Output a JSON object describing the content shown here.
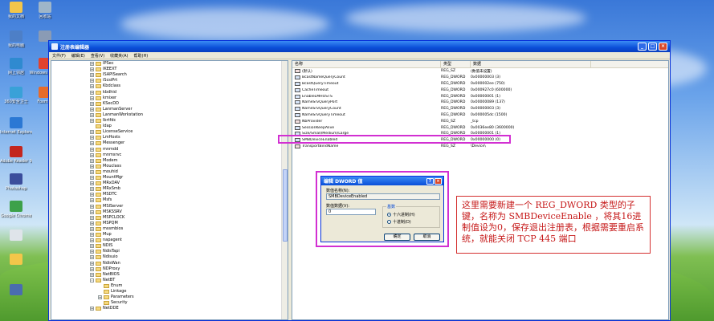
{
  "desktop": {
    "icons": [
      {
        "label": "我的文档",
        "icon": "folder-icon",
        "color": "#f3c64a"
      },
      {
        "label": "回收站",
        "icon": "recycle-bin-icon",
        "color": "#9fb6c9"
      },
      {
        "label": "我的电脑",
        "icon": "computer-icon",
        "color": "#4d7fc7"
      },
      {
        "label": "",
        "icon": "window-icon",
        "color": "#8a9bb5"
      },
      {
        "label": "网上邻居",
        "icon": "network-icon",
        "color": "#2f8ad0"
      },
      {
        "label": "Windows Media",
        "icon": "media-player-icon",
        "color": "#e2422e"
      },
      {
        "label": "360安全卫士",
        "icon": "shield-icon",
        "color": "#39a1d8"
      },
      {
        "label": "Foxmail",
        "icon": "mail-icon",
        "color": "#e76b2a"
      },
      {
        "label": "Internet Explorer",
        "icon": "internet-explorer-icon",
        "color": "#2b78d4"
      },
      {
        "label": "Adobe Reader 9",
        "icon": "pdf-icon",
        "color": "#c3261f"
      },
      {
        "label": "Photoshop",
        "icon": "photoshop-icon",
        "color": "#3b4d9c"
      },
      {
        "label": "Google Chrome",
        "icon": "chrome-icon",
        "color": "#3da14a"
      },
      {
        "label": "",
        "icon": "document-icon",
        "color": "#dfe4ea"
      },
      {
        "label": "",
        "icon": "folder-icon",
        "color": "#f3c64a"
      },
      {
        "label": "",
        "icon": "shortcut-icon",
        "color": "#4a6db0"
      }
    ]
  },
  "window": {
    "title": "注册表编辑器",
    "menu": [
      "文件(F)",
      "编辑(E)",
      "查看(V)",
      "收藏夹(A)",
      "帮助(H)"
    ],
    "tree_items": [
      {
        "label": "IPSec",
        "pm": "+"
      },
      {
        "label": "IKEEXT",
        "pm": "+"
      },
      {
        "label": "ISAPISearch",
        "pm": "+"
      },
      {
        "label": "iScsiPrt",
        "pm": "+"
      },
      {
        "label": "Kbdclass",
        "pm": "+"
      },
      {
        "label": "kbdhid",
        "pm": "+"
      },
      {
        "label": "kmixer",
        "pm": "+"
      },
      {
        "label": "KSecDD",
        "pm": "+"
      },
      {
        "label": "LanmanServer",
        "pm": "+"
      },
      {
        "label": "LanmanWorkstation",
        "pm": "+"
      },
      {
        "label": "lbrtfdc",
        "pm": "+"
      },
      {
        "label": "ldap",
        "pm": ""
      },
      {
        "label": "LicenseService",
        "pm": "+"
      },
      {
        "label": "LmHosts",
        "pm": "+"
      },
      {
        "label": "Messenger",
        "pm": "+"
      },
      {
        "label": "mnmdd",
        "pm": "+"
      },
      {
        "label": "mnmsrvc",
        "pm": "+"
      },
      {
        "label": "Modem",
        "pm": "+"
      },
      {
        "label": "Mouclass",
        "pm": "+"
      },
      {
        "label": "mouhid",
        "pm": "+"
      },
      {
        "label": "MountMgr",
        "pm": "+"
      },
      {
        "label": "MRxDAV",
        "pm": "+"
      },
      {
        "label": "MRxSmb",
        "pm": "+"
      },
      {
        "label": "MSDTC",
        "pm": "+"
      },
      {
        "label": "Msfs",
        "pm": "+"
      },
      {
        "label": "MSIServer",
        "pm": "+"
      },
      {
        "label": "MSKSSRV",
        "pm": "+"
      },
      {
        "label": "MSPCLOCK",
        "pm": "+"
      },
      {
        "label": "MSPQM",
        "pm": "+"
      },
      {
        "label": "mssmbios",
        "pm": "+"
      },
      {
        "label": "Mup",
        "pm": "+"
      },
      {
        "label": "napagent",
        "pm": "+"
      },
      {
        "label": "NDIS",
        "pm": "+"
      },
      {
        "label": "NdisTapi",
        "pm": "+"
      },
      {
        "label": "Ndisuio",
        "pm": "+"
      },
      {
        "label": "NdisWan",
        "pm": "+"
      },
      {
        "label": "NDProxy",
        "pm": "+"
      },
      {
        "label": "NetBIOS",
        "pm": "+"
      },
      {
        "label": "NetBT",
        "pm": "-"
      },
      {
        "label": "Enum",
        "pm": "",
        "indent": 1
      },
      {
        "label": "Linkage",
        "pm": "",
        "indent": 1
      },
      {
        "label": "Parameters",
        "pm": "+",
        "indent": 1
      },
      {
        "label": "Security",
        "pm": "",
        "indent": 1
      },
      {
        "label": "NetDDE",
        "pm": "+"
      }
    ],
    "columns": {
      "name": "名称",
      "type": "类型",
      "data": "数据"
    },
    "values": [
      {
        "name": "(默认)",
        "type": "REG_SZ",
        "data": "(数值未设置)",
        "kind": "sz"
      },
      {
        "name": "BcastNameQueryCount",
        "type": "REG_DWORD",
        "data": "0x00000003 (3)",
        "kind": "dw"
      },
      {
        "name": "BcastQueryTimeout",
        "type": "REG_DWORD",
        "data": "0x000002ee (750)",
        "kind": "dw"
      },
      {
        "name": "CacheTimeout",
        "type": "REG_DWORD",
        "data": "0x000927c0 (600000)",
        "kind": "dw"
      },
      {
        "name": "EnableLMHOSTS",
        "type": "REG_DWORD",
        "data": "0x00000001 (1)",
        "kind": "dw"
      },
      {
        "name": "NameSrvQueryPort",
        "type": "REG_DWORD",
        "data": "0x00000089 (137)",
        "kind": "dw"
      },
      {
        "name": "NameSrvQueryCount",
        "type": "REG_DWORD",
        "data": "0x00000003 (3)",
        "kind": "dw"
      },
      {
        "name": "NameSrvQueryTimeout",
        "type": "REG_DWORD",
        "data": "0x000005dc (1500)",
        "kind": "dw"
      },
      {
        "name": "NbProvider",
        "type": "REG_SZ",
        "data": "_tcp",
        "kind": "sz"
      },
      {
        "name": "SessionKeepAlive",
        "type": "REG_DWORD",
        "data": "0x0036ee80 (3600000)",
        "kind": "dw"
      },
      {
        "name": "Size/Small/Medium/Large",
        "type": "REG_DWORD",
        "data": "0x00000001 (1)",
        "kind": "dw"
      },
      {
        "name": "SMBDeviceEnabled",
        "type": "REG_DWORD",
        "data": "0x00000000 (0)",
        "kind": "dw"
      },
      {
        "name": "TransportBindName",
        "type": "REG_SZ",
        "data": "\\Device\\",
        "kind": "sz"
      }
    ]
  },
  "dialog": {
    "title": "编辑 DWORD 值",
    "help": "?",
    "close": "×",
    "name_label": "数值名称(N):",
    "name_value": "SMBDeviceEnabled",
    "data_label": "数值数据(V):",
    "data_value": "0",
    "base_label": "基数",
    "hex_label": "十六进制(H)",
    "dec_label": "十进制(D)",
    "ok": "确定",
    "cancel": "取消"
  },
  "note": {
    "text": "这里需要新建一个 REG_DWORD 类型的子键，名称为 SMBDeviceEnable ，将其16进制值设为0，保存退出注册表，根据需要重启系统，就能关闭 TCP 445 端口"
  }
}
